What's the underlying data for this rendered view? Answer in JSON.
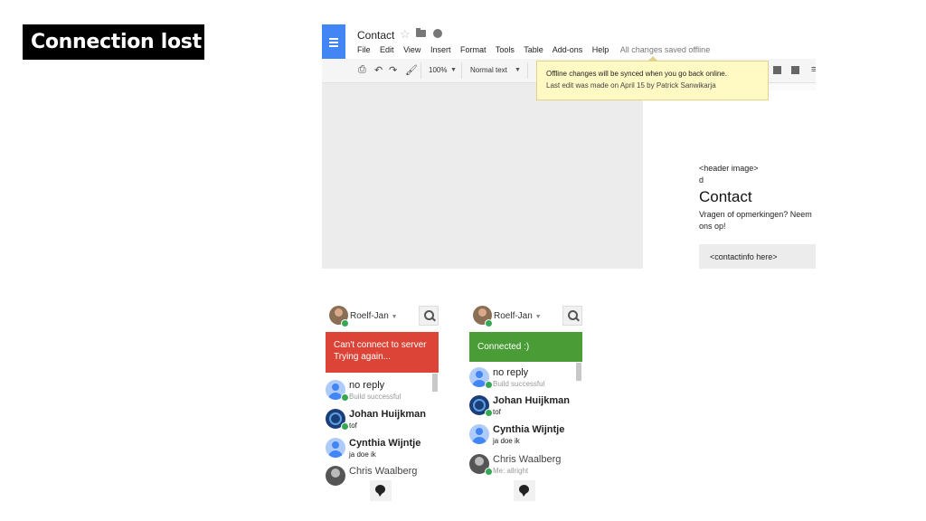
{
  "slide": {
    "title": "Connection lost"
  },
  "docs": {
    "doc_title": "Contact",
    "icons": {
      "app": "docs-icon",
      "star": "star-icon",
      "folder": "folder-icon",
      "drive": "drive-icon"
    },
    "menu": [
      "File",
      "Edit",
      "View",
      "Insert",
      "Format",
      "Tools",
      "Table",
      "Add-ons",
      "Help"
    ],
    "saved_status": "All changes saved offline",
    "toolbar": {
      "zoom": "100%",
      "style": "Normal text"
    },
    "tooltip": {
      "line1": "Offline changes will be synced when you go back online.",
      "line2": "Last edit was made on April 15 by Patrick Sanwikarja"
    },
    "content": {
      "header_image": "<header image>",
      "d": "d",
      "heading": "Contact",
      "paragraph_line1": "Vragen of opmerkingen? Neem",
      "paragraph_line2": "ons op!",
      "contactinfo": "<contactinfo here>"
    }
  },
  "hangouts": [
    {
      "user": "Roelf-Jan",
      "banner_line1": "Can't connect to server",
      "banner_line2": "Trying again...",
      "banner_color": "#db4437",
      "contacts": [
        {
          "name": "no reply",
          "status": "Build successful"
        },
        {
          "name": "Johan Huijkman",
          "status": "tof"
        },
        {
          "name": "Cynthia Wijntje",
          "status": "ja doe ik"
        },
        {
          "name": "Chris Waalberg",
          "status": ""
        }
      ]
    },
    {
      "user": "Roelf-Jan",
      "banner_line1": "Connected :)",
      "banner_color": "#4a9c36",
      "contacts": [
        {
          "name": "no reply",
          "status": "Build successful"
        },
        {
          "name": "Johan Huijkman",
          "status": "tof"
        },
        {
          "name": "Cynthia Wijntje",
          "status": "ja doe ik"
        },
        {
          "name": "Chris Waalberg",
          "status": "Me: allright"
        }
      ]
    }
  ]
}
